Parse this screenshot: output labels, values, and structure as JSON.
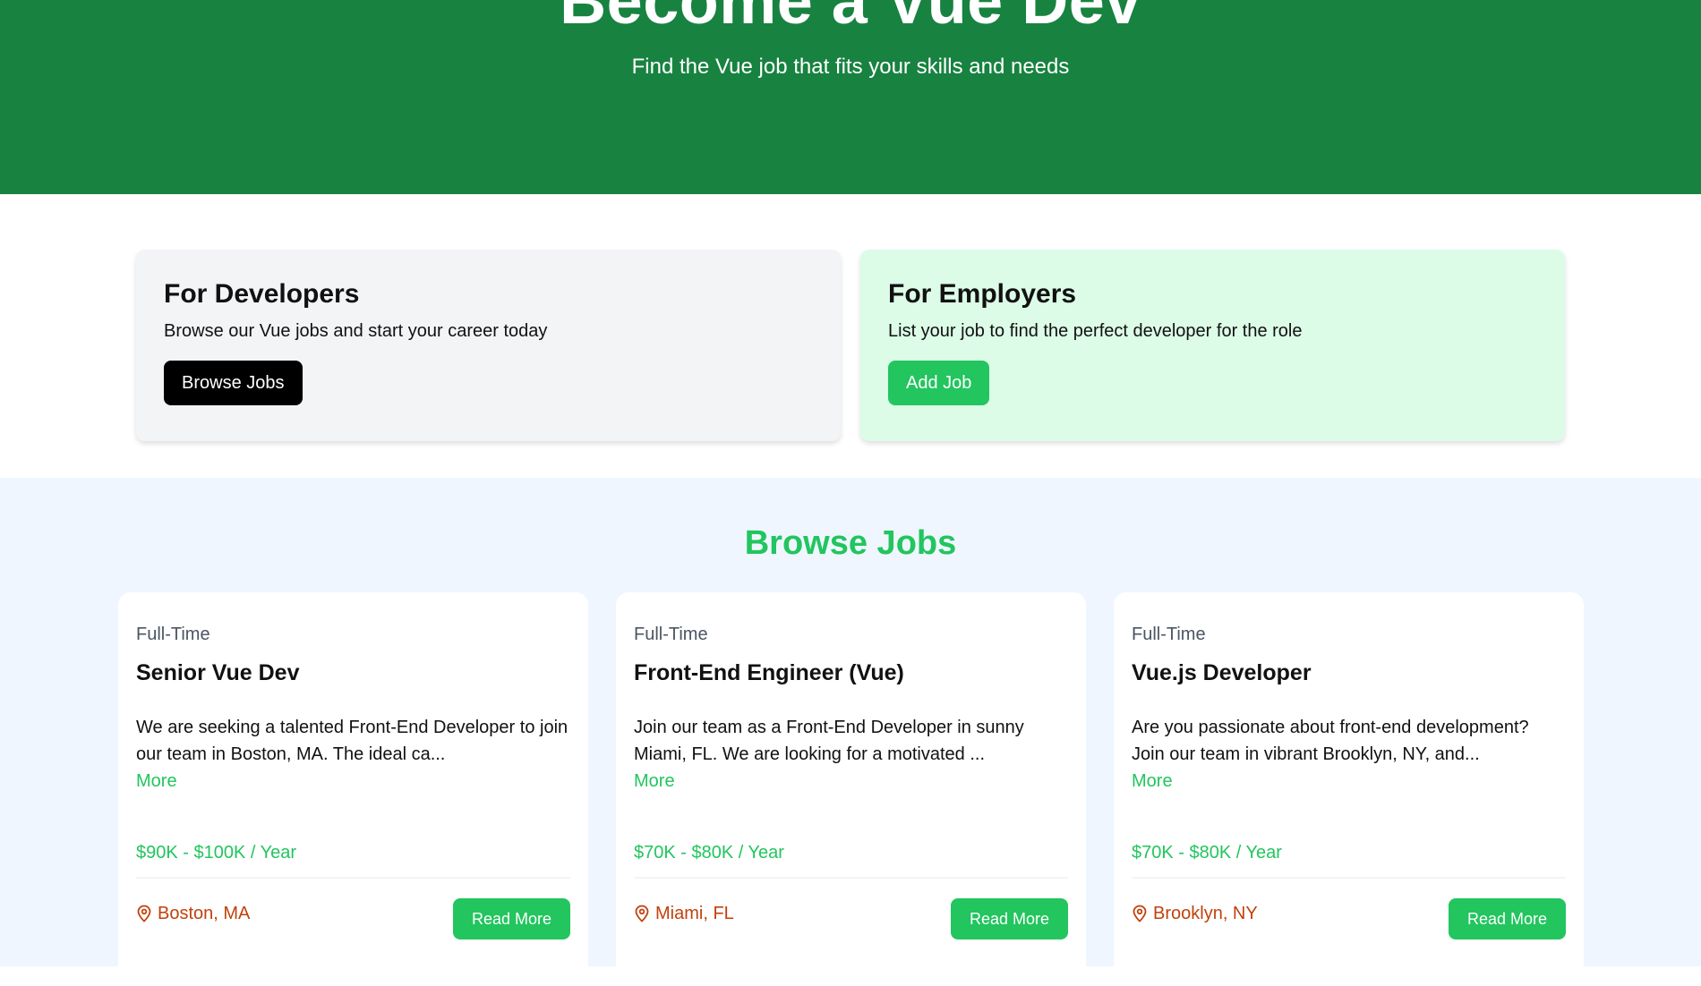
{
  "hero": {
    "title": "Become a Vue Dev",
    "subtitle": "Find the Vue job that fits your skills and needs"
  },
  "developers": {
    "title": "For Developers",
    "text": "Browse our Vue jobs and start your career today",
    "button": "Browse Jobs"
  },
  "employers": {
    "title": "For Employers",
    "text": "List your job to find the perfect developer for the role",
    "button": "Add Job"
  },
  "browse": {
    "title": "Browse Jobs",
    "jobs": [
      {
        "type": "Full-Time",
        "title": "Senior Vue Dev",
        "description": "We are seeking a talented Front-End Developer to join our team in Boston, MA. The ideal ca...",
        "more": "More",
        "salary": "$90K - $100K / Year",
        "location": "Boston, MA",
        "button": "Read More"
      },
      {
        "type": "Full-Time",
        "title": "Front-End Engineer (Vue)",
        "description": "Join our team as a Front-End Developer in sunny Miami, FL. We are looking for a motivated ...",
        "more": "More",
        "salary": "$70K - $80K / Year",
        "location": "Miami, FL",
        "button": "Read More"
      },
      {
        "type": "Full-Time",
        "title": "Vue.js Developer",
        "description": "Are you passionate about front-end development? Join our team in vibrant Brooklyn, NY, and...",
        "more": "More",
        "salary": "$70K - $80K / Year",
        "location": "Brooklyn, NY",
        "button": "Read More"
      }
    ]
  },
  "colors": {
    "hero_bg": "#188240",
    "accent_green": "#22c55e",
    "location_orange": "#c2410c",
    "employers_bg": "#dcfce7",
    "browse_bg": "#eff6ff"
  },
  "icons": {
    "location": "map-pin-icon"
  }
}
